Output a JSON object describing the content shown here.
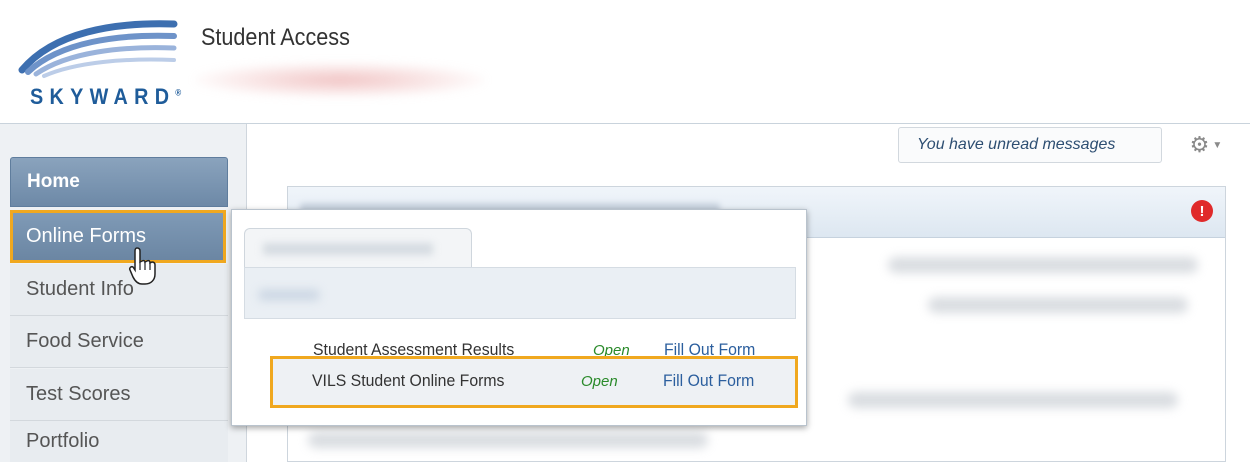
{
  "header": {
    "logo_text": "SKYWARD",
    "app_title": "Student Access"
  },
  "topbar": {
    "messages_text": "You have unread messages",
    "settings_icon": "gear-icon"
  },
  "sidebar": {
    "items": [
      {
        "label": "Home"
      },
      {
        "label": "Online Forms"
      },
      {
        "label": "Student Info"
      },
      {
        "label": "Food Service"
      },
      {
        "label": "Test Scores"
      },
      {
        "label": "Portfolio"
      }
    ]
  },
  "popover": {
    "forms": [
      {
        "name": "Student Assessment Results",
        "status": "Open",
        "action": "Fill Out Form"
      },
      {
        "name": "VILS Student Online Forms",
        "status": "Open",
        "action": "Fill Out Form"
      }
    ]
  },
  "colors": {
    "highlight": "#f0a81f",
    "nav_active": "#6d89a7",
    "status_open": "#2a8a2a",
    "link": "#2c5f9e",
    "alert": "#e02a2a"
  }
}
